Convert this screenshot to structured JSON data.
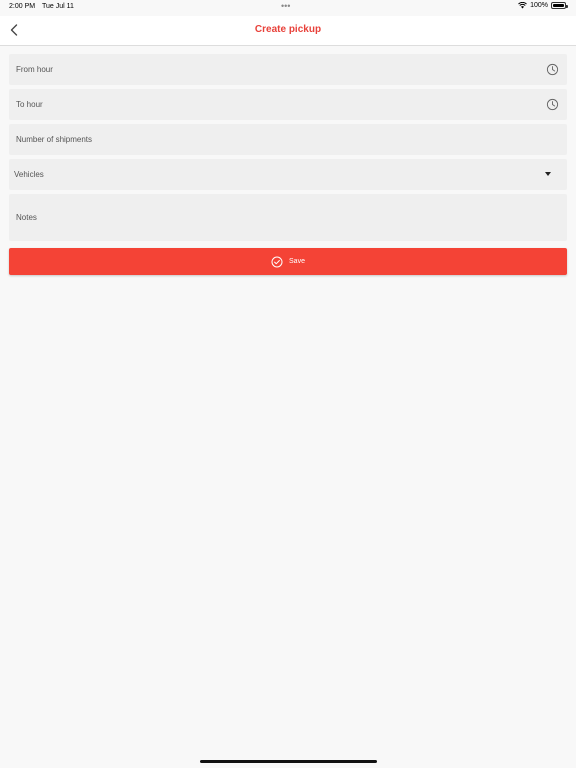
{
  "status_bar": {
    "time": "2:00 PM",
    "date": "Tue Jul 11",
    "dots": "•••",
    "battery_text": "100%",
    "wifi_icon": "wifi-icon",
    "battery_icon": "battery-icon"
  },
  "nav": {
    "title": "Create pickup",
    "back_icon": "chevron-left-icon"
  },
  "form": {
    "from_hour": {
      "label": "From hour",
      "icon": "clock-icon"
    },
    "to_hour": {
      "label": "To hour",
      "icon": "clock-icon"
    },
    "shipments": {
      "label": "Number of shipments"
    },
    "vehicles": {
      "label": "Vehicles",
      "icon": "caret-down-icon"
    },
    "notes": {
      "label": "Notes"
    }
  },
  "save_button": {
    "label": "Save",
    "icon": "check-circle-icon"
  },
  "colors": {
    "accent": "#f44336",
    "title": "#e8413a",
    "field_bg": "#efefef",
    "page_bg": "#f8f8f8"
  }
}
